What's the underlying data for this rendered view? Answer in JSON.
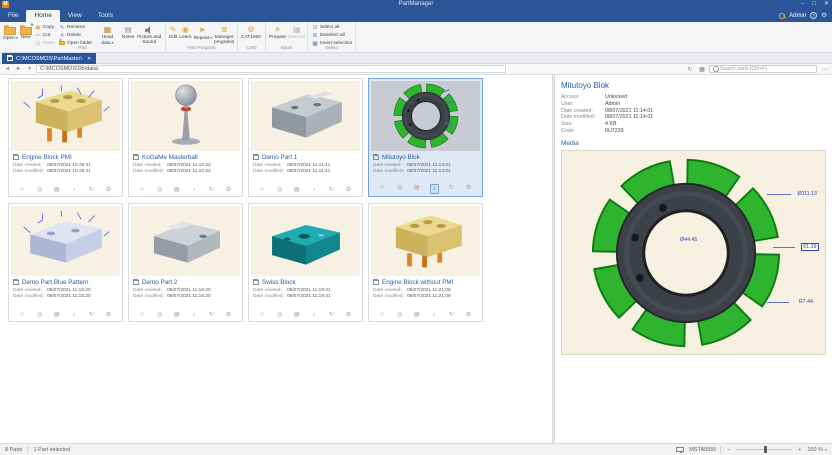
{
  "titlebar": {
    "title": "PartManager"
  },
  "tabs": {
    "file": "File",
    "home": "Home",
    "view": "View",
    "tools": "Tools"
  },
  "user_area": {
    "name": "Admin"
  },
  "ribbon": {
    "part": {
      "label": "Part",
      "open": "Open",
      "new": "New",
      "copy": "Copy",
      "cut": "Cut",
      "paste": "Paste",
      "rename": "Rename",
      "delete": "Delete",
      "open_folder": "Open folder",
      "head_data": "Head data",
      "notes": "Notes",
      "picture_sound": "Picture and Sound"
    },
    "part_program": {
      "label": "Part Program",
      "edit": "Edit",
      "learn": "Learn",
      "repeat": "Repeat",
      "manager": "Manager programs"
    },
    "cad": {
      "label": "CAD",
      "cat1000": "CAT1000"
    },
    "stack": {
      "label": "Stack",
      "prepare": "Prepare",
      "execute": "Execute"
    },
    "select": {
      "label": "Select",
      "select_all": "Select all",
      "deselect_all": "Deselect all",
      "invert": "Invert selection"
    }
  },
  "document_tab": {
    "path": "C:\\MCOSMOS\\PartMaster\\"
  },
  "nav": {
    "path": "C:\\MCOSMOS\\Db\\data\\",
    "search_placeholder": "Search parts (Ctrl+F)"
  },
  "card_labels": {
    "created": "Date created:",
    "modified": "Date modified:"
  },
  "parts": [
    {
      "name": "Engine Block PMI",
      "created": "08/07/2021 10:35:41",
      "modified": "08/07/2021 10:35:41"
    },
    {
      "name": "KoGaMe Masterball",
      "created": "08/07/2021 11:10:22",
      "modified": "08/07/2021 11:10:22"
    },
    {
      "name": "Demo Part 1",
      "created": "08/07/2021 11:11:41",
      "modified": "08/07/2021 11:11:41"
    },
    {
      "name": "Mitutoyo Blok",
      "created": "08/07/2021 11:14:01",
      "modified": "08/07/2021 11:14:01"
    },
    {
      "name": "Demo Part Blue Pattern",
      "created": "08/07/2021 11:15:20",
      "modified": "08/07/2021 11:15:20"
    },
    {
      "name": "Demo Part 2",
      "created": "08/07/2021 11:16:20",
      "modified": "08/07/2021 11:16:20"
    },
    {
      "name": "Swiss Block",
      "created": "08/07/2021 11:19:41",
      "modified": "08/07/2021 11:19:41"
    },
    {
      "name": "Engine Block without PMI",
      "created": "08/07/2021 11:21:08",
      "modified": "08/07/2021 11:21:08"
    }
  ],
  "detail": {
    "title": "Mitutoyo Blok",
    "fields": [
      {
        "label": "Access:",
        "value": "Unlocked"
      },
      {
        "label": "User:",
        "value": "Admin"
      },
      {
        "label": "Date created:",
        "value": "08/07/2021 11:14:01"
      },
      {
        "label": "Date modified:",
        "value": "08/07/2021 11:14:01"
      },
      {
        "label": "Size:",
        "value": "4 KB"
      },
      {
        "label": "Code:",
        "value": "0U7239"
      }
    ],
    "media_label": "Media",
    "annotations": [
      {
        "text": "Ø111.13"
      },
      {
        "text": "61.19"
      },
      {
        "text": "R7.44"
      },
      {
        "text": "Ø44.45"
      }
    ]
  },
  "status": {
    "parts_count": "8 Parts",
    "selection": "1 Part selected",
    "machine": "MSTA0555",
    "zoom_level": "100 %"
  },
  "icons": {
    "logo": "M",
    "minimize": "–",
    "maximize": "□",
    "close": "✕",
    "caret": "▾",
    "help": "?",
    "gear": "⚙",
    "back": "◄",
    "forward": "►",
    "refresh": "↻",
    "views": "▦",
    "more": "⋯",
    "copy": "▣",
    "cut": "✂",
    "paste": "▤",
    "rename": "✎",
    "delete": "✕",
    "edit": "✎",
    "learn": "◉",
    "repeat": "►",
    "manager": "≣",
    "cat1000": "⚙",
    "prepare": "✳",
    "execute": "▦",
    "select_all": "☑",
    "deselect_all": "☒",
    "invert": "▩",
    "minus": "–",
    "plus": "+"
  },
  "card_icons": [
    "⚐",
    "◎",
    "▤",
    "♪",
    "↻",
    "⚙"
  ],
  "colors": {
    "accent_blue": "#2a5699",
    "icon_orange": "#e7a33c",
    "part_green": "#2eb42e",
    "link_blue": "#2a5da8"
  }
}
